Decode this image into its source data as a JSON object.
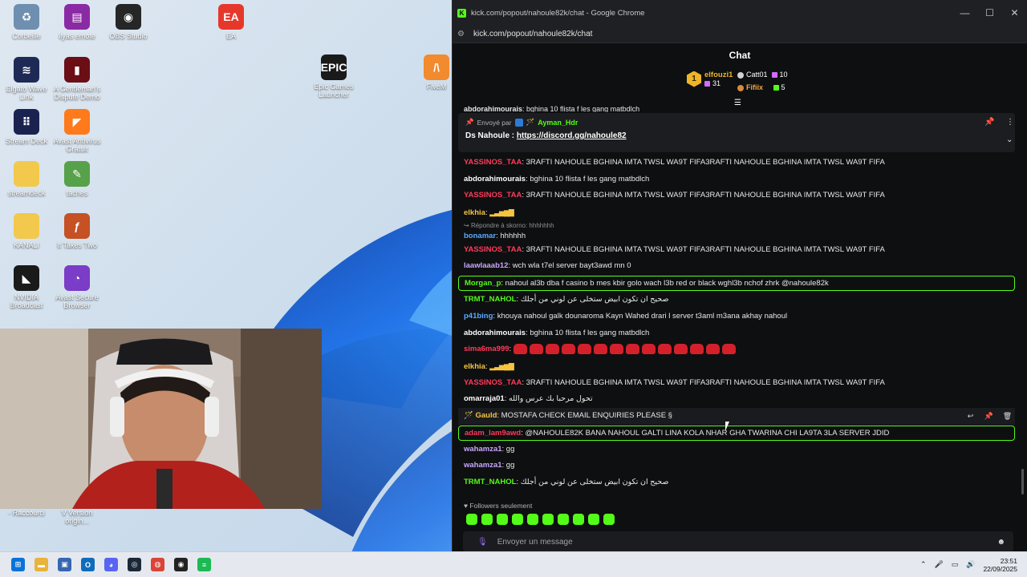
{
  "desktop": {
    "icons": [
      {
        "label": "Corbeille",
        "icon": "recycle-bin-icon",
        "glyph": "♻",
        "color": "#6f8fb0"
      },
      {
        "label": "ilyas emote",
        "icon": "winrar-icon",
        "glyph": "▤",
        "color": "#8b2aa5"
      },
      {
        "label": "OBS Studio",
        "icon": "obs-icon",
        "glyph": "◉",
        "color": "#262626"
      },
      {
        "label": "EA",
        "icon": "ea-icon",
        "glyph": "EA",
        "color": "#e6372b"
      },
      {
        "label": "Elgato Wave Link",
        "icon": "elgato-icon",
        "glyph": "≋",
        "color": "#1e2a55"
      },
      {
        "label": "A Gentleman's Dispute Demo",
        "icon": "tophat-icon",
        "glyph": "▮",
        "color": "#6b0e16"
      },
      {
        "label": "Epic Games Launcher",
        "icon": "epic-games-icon",
        "glyph": "EPIC",
        "color": "#1a1a1a"
      },
      {
        "label": "FiveM",
        "icon": "fivem-icon",
        "glyph": "/\\",
        "color": "#f28a2e"
      },
      {
        "label": "Stream Deck",
        "icon": "stream-deck-icon",
        "glyph": "⠿",
        "color": "#1a2350"
      },
      {
        "label": "Avast Antivirus Gratuit",
        "icon": "avast-icon",
        "glyph": "◤",
        "color": "#ff7a1a"
      },
      {
        "label": "streamdeck",
        "icon": "folder-icon",
        "glyph": "",
        "color": "#f2c94c"
      },
      {
        "label": "taches",
        "icon": "notepad-icon",
        "glyph": "✎",
        "color": "#56a14a"
      },
      {
        "label": "KANALI",
        "icon": "folder-icon",
        "glyph": "",
        "color": "#f2c94c"
      },
      {
        "label": "It Takes Two",
        "icon": "it-takes-two-icon",
        "glyph": "ƒ",
        "color": "#c55124"
      },
      {
        "label": "NVIDIA Broadcast",
        "icon": "nvidia-icon",
        "glyph": "◣",
        "color": "#1a1a1a"
      },
      {
        "label": "Avast Secure Browser",
        "icon": "avast-browser-icon",
        "glyph": "◔",
        "color": "#7b3cc8"
      },
      {
        "label": "- Raccourci",
        "icon": "shortcut-icon",
        "glyph": "",
        "color": "#d11a2a"
      },
      {
        "label": "V Version origin...",
        "icon": "shortcut-icon",
        "glyph": "",
        "color": "#334"
      }
    ]
  },
  "browser": {
    "title": "kick.com/popout/nahoule82k/chat - Google Chrome",
    "url": "kick.com/popout/nahoule82k/chat"
  },
  "chat": {
    "header": "Chat",
    "leaderboard": {
      "first": {
        "rank": "1",
        "name": "elfouzi1",
        "count": "31"
      },
      "second": {
        "name": "Catt01",
        "count": "10"
      },
      "third": {
        "name": "Fifiix",
        "count": "5"
      }
    },
    "pinned": {
      "sent_by_label": "Envoyé par",
      "sender": "Ayman_Hdr",
      "text_prefix": "Ds Nahoule : ",
      "link": "https://discord.gg/nahoule82"
    },
    "partial_top": {
      "user": "abdorahimourais",
      "text": ": bghina 10 flista f les gang matbdlch"
    },
    "messages": [
      {
        "user": "YASSINOS_TAA",
        "color": "#ff3b5c",
        "text": ": 3RAFTI NAHOULE BGHINA IMTA TWSL WA9T FIFA3RAFTI NAHOULE BGHINA IMTA TWSL WA9T FIFA"
      },
      {
        "user": "abdorahimourais",
        "color": "#ffffff",
        "text": ": bghina 10 flista f les gang matbdlch"
      },
      {
        "user": "YASSINOS_TAA",
        "color": "#ff3b5c",
        "text": ": 3RAFTI NAHOULE BGHINA IMTA TWSL WA9T FIFA3RAFTI NAHOULE BGHINA IMTA TWSL WA9T FIFA"
      },
      {
        "user": "elkhia",
        "color": "#f5c542",
        "text": ": ",
        "bars": "▂▃▅▆▇"
      },
      {
        "reply": "Répondre à skorno: hhhhhhh"
      },
      {
        "user": "bonamar",
        "color": "#5aa9ff",
        "text": ": hhhhhh",
        "first": true
      },
      {
        "user": "YASSINOS_TAA",
        "color": "#ff3b5c",
        "text": ": 3RAFTI NAHOULE BGHINA IMTA TWSL WA9T FIFA3RAFTI NAHOULE BGHINA IMTA TWSL WA9T FIFA"
      },
      {
        "user": "laawlaaab12",
        "color": "#c9a7ff",
        "text": ": wch wla t7el server bayt3awd mn 0"
      },
      {
        "user": "Morgan_p",
        "color": "#53fc18",
        "text": ": nahoul al3b dba f casino b mes kbir golo wach l3b red or black wghl3b nchof zhrk @nahoule82k",
        "highlight": true
      },
      {
        "user": "TRMT_NAHOL",
        "color": "#53fc18",
        "text": ": صحيح ان تكون ابيض ستخلى عن لوني من أجلك"
      },
      {
        "user": "p41bing",
        "color": "#5aa9ff",
        "text": ": khouya nahoul galk dounaroma Kayn Wahed drari l server t3aml m3ana akhay nahoul"
      },
      {
        "user": "abdorahimourais",
        "color": "#ffffff",
        "text": ": bghina 10 flista f les gang matbdlch"
      },
      {
        "user": "sima6ma999",
        "color": "#ff3b5c",
        "text": ": ",
        "emotes": 14
      },
      {
        "user": "elkhia",
        "color": "#f5c542",
        "text": ": ",
        "bars": "▂▃▅▆▇"
      },
      {
        "user": "YASSINOS_TAA",
        "color": "#ff3b5c",
        "text": ": 3RAFTI NAHOULE BGHINA IMTA TWSL WA9T FIFA3RAFTI NAHOULE BGHINA IMTA TWSL WA9T FIFA"
      },
      {
        "user": "omarraja01",
        "color": "#ffffff",
        "text": ": تحول مرحبا بك عرس والله"
      },
      {
        "user": "Gauld",
        "color": "#f5c542",
        "text": ": MOSTAFA CHECK EMAIL ENQUIRIES PLEASE §",
        "hover": true,
        "prefix": "🪄 "
      },
      {
        "user": "adam_lam9awd",
        "color": "#ff3b5c",
        "text": ": @NAHOULE82K BANA NAHOUL GALTI LINA KOLA NHAR GHA TWARINA CHI LA9TA 3LA SERVER JDID",
        "highlight": true
      },
      {
        "user": "wahamza1",
        "color": "#c9a7ff",
        "text": ": gg"
      },
      {
        "user": "wahamza1",
        "color": "#c9a7ff",
        "text": ": gg"
      },
      {
        "user": "TRMT_NAHOL",
        "color": "#53fc18",
        "text": ": صحيح ان تكون ابيض ستخلى عن لوني من أجلك"
      }
    ],
    "followers_only": "Followers seulement",
    "input_placeholder": "Envoyer un message"
  },
  "taskbar": {
    "time": "23:51",
    "date": "22/09/2025",
    "apps": [
      {
        "name": "start-icon",
        "glyph": "⊞",
        "color": "#0a73d9"
      },
      {
        "name": "file-explorer-icon",
        "glyph": "▬",
        "color": "#e8b33a"
      },
      {
        "name": "store-icon",
        "glyph": "▣",
        "color": "#3766b2"
      },
      {
        "name": "outlook-icon",
        "glyph": "O",
        "color": "#0f6cbd"
      },
      {
        "name": "discord-icon",
        "glyph": "◕",
        "color": "#5865f2"
      },
      {
        "name": "steam-icon",
        "glyph": "◎",
        "color": "#1b2838"
      },
      {
        "name": "chrome-icon",
        "glyph": "◍",
        "color": "#db4437"
      },
      {
        "name": "obs-taskbar-icon",
        "glyph": "◉",
        "color": "#222"
      },
      {
        "name": "spotify-icon",
        "glyph": "≡",
        "color": "#1db954"
      }
    ]
  }
}
